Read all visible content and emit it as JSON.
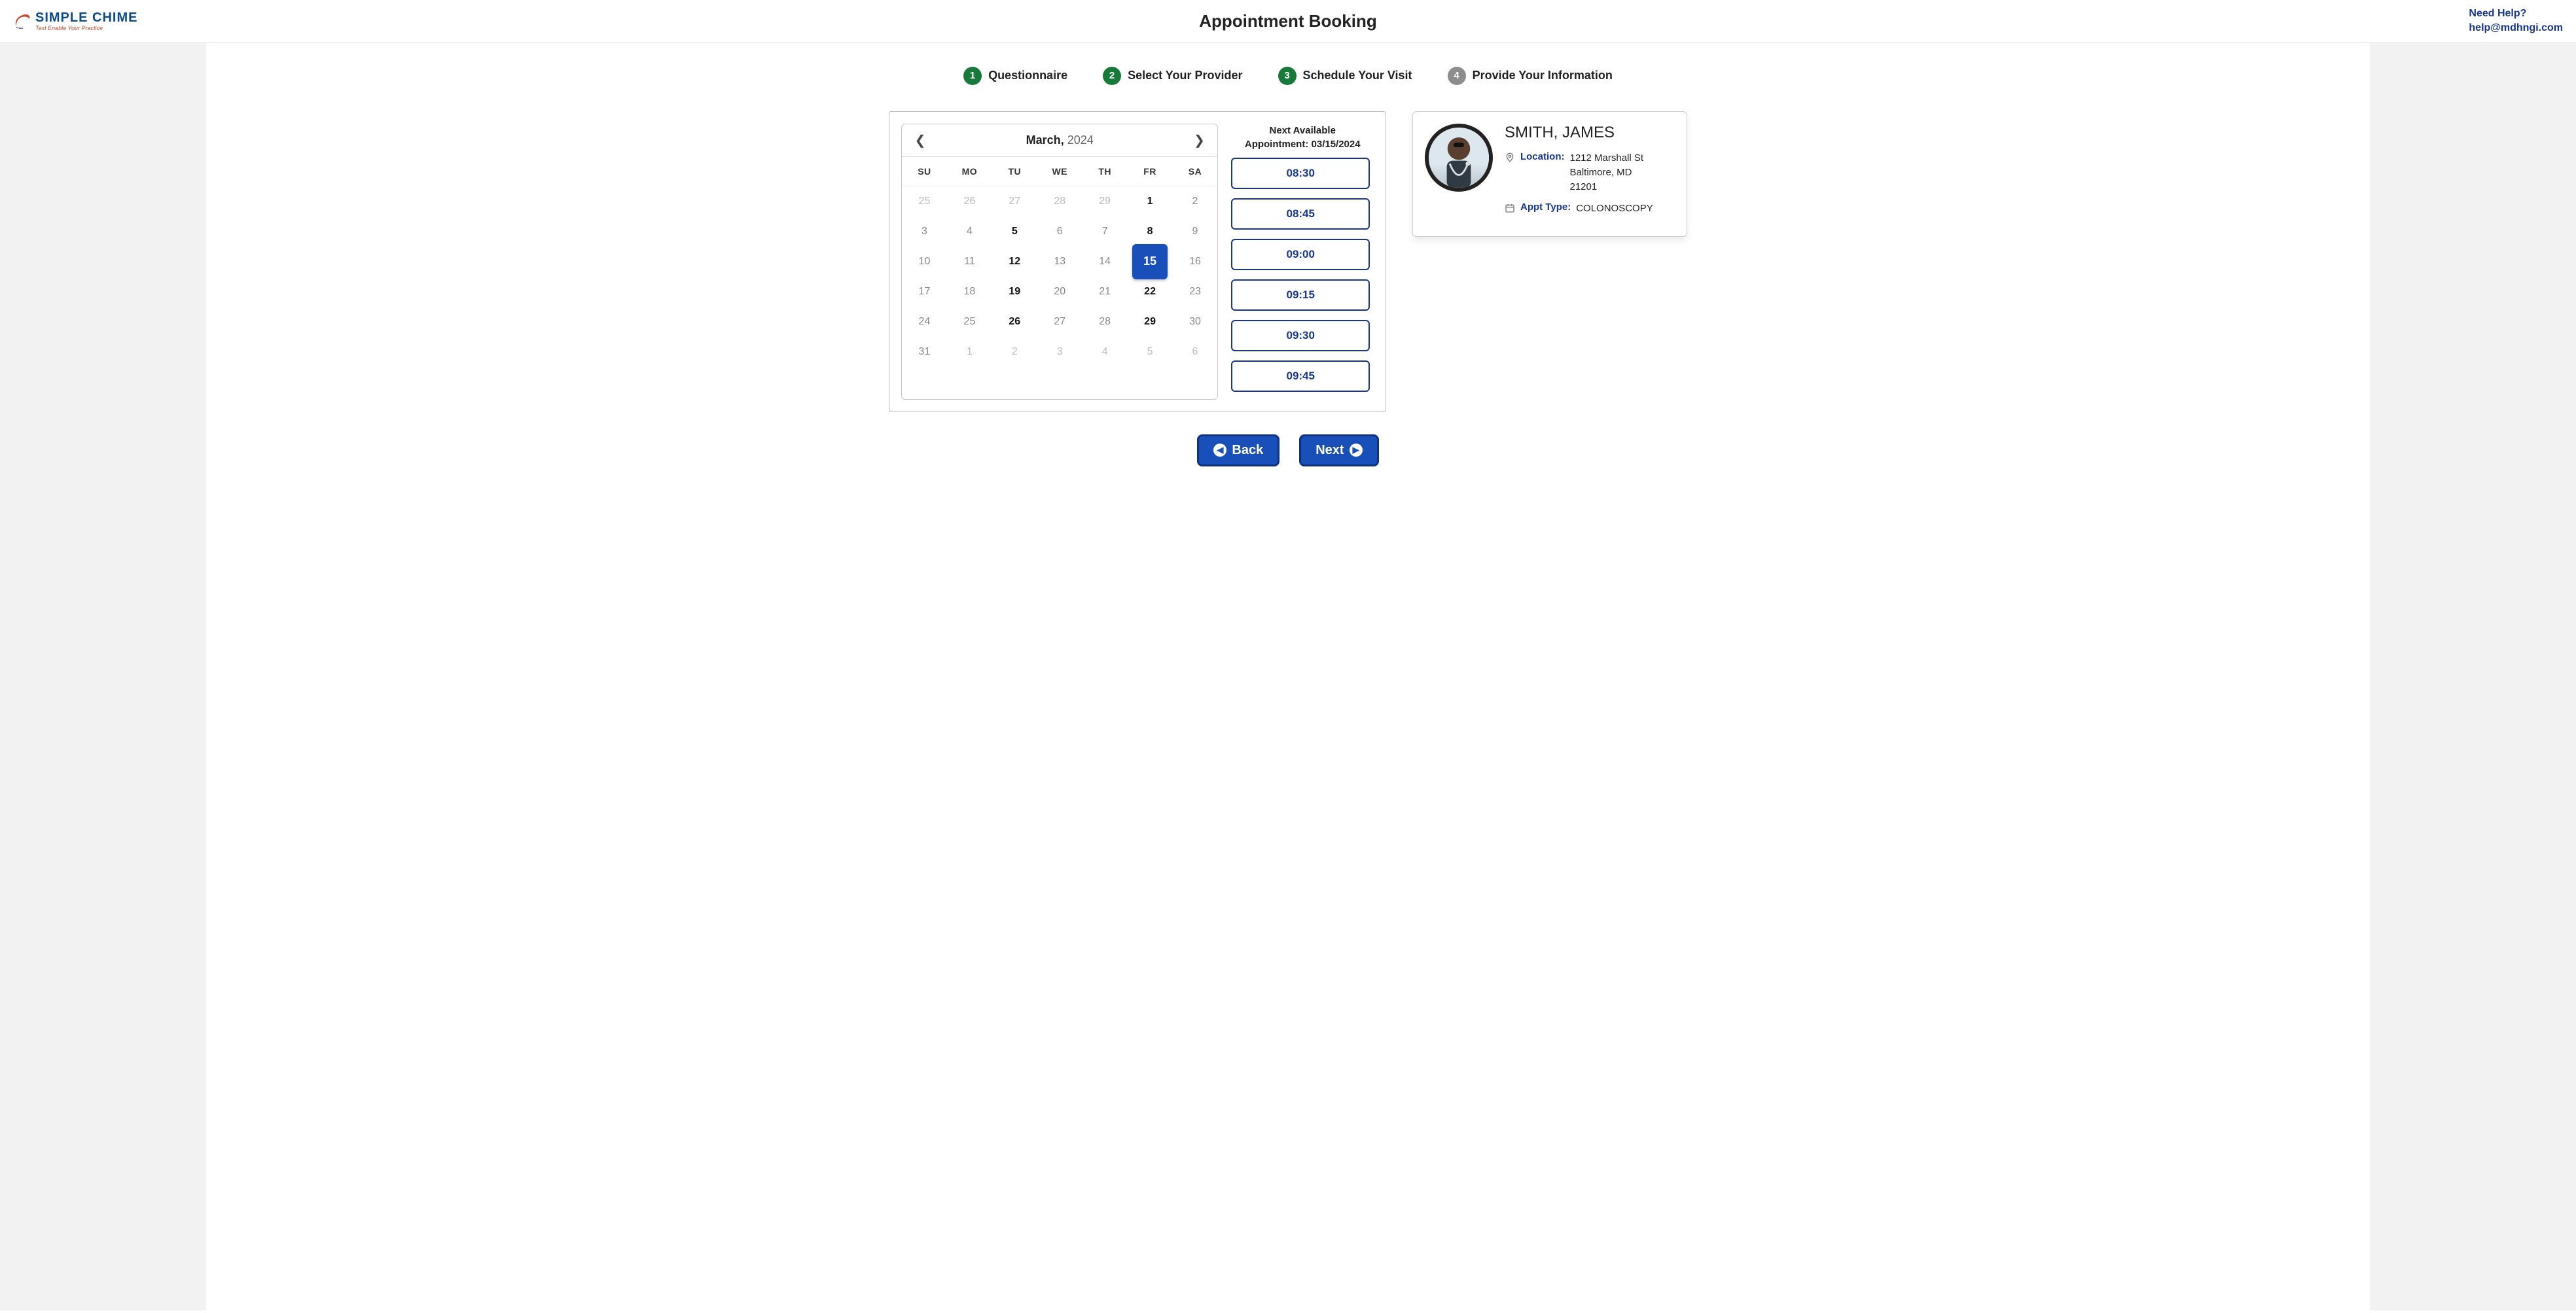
{
  "header": {
    "logo_main": "SIMPLE CHIME",
    "logo_tag": "Text Enable Your Practice",
    "page_title": "Appointment Booking",
    "help_prompt": "Need Help?",
    "help_email": "help@mdhngi.com"
  },
  "stepper": [
    {
      "num": "1",
      "label": "Questionnaire",
      "status": "done"
    },
    {
      "num": "2",
      "label": "Select Your Provider",
      "status": "done"
    },
    {
      "num": "3",
      "label": "Schedule Your Visit",
      "status": "done"
    },
    {
      "num": "4",
      "label": "Provide Your Information",
      "status": "pending"
    }
  ],
  "calendar": {
    "month": "March,",
    "year": "2024",
    "dow": [
      "SU",
      "MO",
      "TU",
      "WE",
      "TH",
      "FR",
      "SA"
    ],
    "grid": [
      [
        {
          "d": "25",
          "t": "other"
        },
        {
          "d": "26",
          "t": "other"
        },
        {
          "d": "27",
          "t": "other"
        },
        {
          "d": "28",
          "t": "other"
        },
        {
          "d": "29",
          "t": "other"
        },
        {
          "d": "1",
          "t": "strong"
        },
        {
          "d": "2",
          "t": "dim"
        }
      ],
      [
        {
          "d": "3",
          "t": "dim"
        },
        {
          "d": "4",
          "t": "dim"
        },
        {
          "d": "5",
          "t": "strong"
        },
        {
          "d": "6",
          "t": "dim"
        },
        {
          "d": "7",
          "t": "dim"
        },
        {
          "d": "8",
          "t": "strong"
        },
        {
          "d": "9",
          "t": "dim"
        }
      ],
      [
        {
          "d": "10",
          "t": "dim"
        },
        {
          "d": "11",
          "t": "dim"
        },
        {
          "d": "12",
          "t": "strong"
        },
        {
          "d": "13",
          "t": "dim"
        },
        {
          "d": "14",
          "t": "dim"
        },
        {
          "d": "15",
          "t": "selected"
        },
        {
          "d": "16",
          "t": "dim"
        }
      ],
      [
        {
          "d": "17",
          "t": "dim"
        },
        {
          "d": "18",
          "t": "dim"
        },
        {
          "d": "19",
          "t": "strong"
        },
        {
          "d": "20",
          "t": "dim"
        },
        {
          "d": "21",
          "t": "dim"
        },
        {
          "d": "22",
          "t": "strong"
        },
        {
          "d": "23",
          "t": "dim"
        }
      ],
      [
        {
          "d": "24",
          "t": "dim"
        },
        {
          "d": "25",
          "t": "dim"
        },
        {
          "d": "26",
          "t": "strong"
        },
        {
          "d": "27",
          "t": "dim"
        },
        {
          "d": "28",
          "t": "dim"
        },
        {
          "d": "29",
          "t": "strong"
        },
        {
          "d": "30",
          "t": "dim"
        }
      ],
      [
        {
          "d": "31",
          "t": "dim"
        },
        {
          "d": "1",
          "t": "other"
        },
        {
          "d": "2",
          "t": "other"
        },
        {
          "d": "3",
          "t": "other"
        },
        {
          "d": "4",
          "t": "other"
        },
        {
          "d": "5",
          "t": "other"
        },
        {
          "d": "6",
          "t": "other"
        }
      ]
    ]
  },
  "slots": {
    "title_line1": "Next Available",
    "title_line2": "Appointment: 03/15/2024",
    "times": [
      "08:30",
      "08:45",
      "09:00",
      "09:15",
      "09:30",
      "09:45"
    ]
  },
  "provider": {
    "name": "SMITH, JAMES",
    "location_label": "Location:",
    "address_line1": "1212 Marshall St",
    "address_line2": "Baltimore, MD",
    "address_line3": "21201",
    "appt_type_label": "Appt Type:",
    "appt_type": "COLONOSCOPY"
  },
  "nav": {
    "back": "Back",
    "next": "Next"
  }
}
